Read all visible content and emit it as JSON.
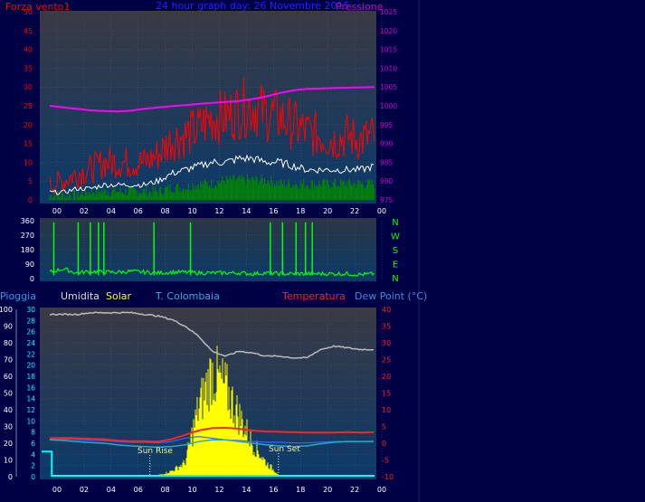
{
  "chart_data": [
    {
      "type": "line",
      "title": "24 hour graph day: 26 Novembre 2015",
      "left_axis_label": "Forza vento1",
      "right_axis_label": "Pressione",
      "x_ticks": [
        "00",
        "02",
        "04",
        "06",
        "08",
        "10",
        "12",
        "14",
        "16",
        "18",
        "20",
        "22",
        "00"
      ],
      "y_left_ticks": [
        "50",
        "45",
        "40",
        "35",
        "30",
        "25",
        "20",
        "15",
        "10",
        "5",
        "0"
      ],
      "y_right_ticks": [
        "1025",
        "1020",
        "1015",
        "1010",
        "1005",
        "1000",
        "995",
        "990",
        "985",
        "980",
        "975"
      ],
      "ylim_left": [
        0,
        50
      ],
      "ylim_right": [
        975,
        1025
      ],
      "x_hours": [
        0,
        1,
        2,
        3,
        4,
        5,
        6,
        7,
        8,
        9,
        10,
        11,
        12,
        13,
        14,
        15,
        16,
        17,
        18,
        19,
        20,
        21,
        22,
        23,
        24
      ],
      "series": [
        {
          "key": "gust",
          "color": "#ff0000",
          "axis": "left",
          "values": [
            4,
            5,
            7,
            8,
            10,
            10,
            10,
            10,
            12,
            16,
            17,
            19,
            22,
            22,
            24,
            25,
            23,
            22,
            20,
            18,
            17,
            16,
            17,
            16,
            17
          ]
        },
        {
          "key": "avg",
          "color": "#ffffff",
          "axis": "left",
          "values": [
            2,
            2,
            3,
            3,
            4,
            4,
            4,
            4,
            5,
            7,
            8,
            9,
            10,
            10,
            11,
            11,
            10,
            10,
            9,
            8,
            8,
            8,
            8,
            8,
            9
          ]
        },
        {
          "key": "speed",
          "color": "#008800",
          "axis": "left",
          "values": [
            1,
            1,
            1,
            2,
            2,
            2,
            2,
            2,
            2,
            3,
            3,
            4,
            4,
            5,
            5,
            5,
            5,
            4,
            4,
            4,
            4,
            4,
            4,
            4,
            4
          ]
        },
        {
          "key": "pressure",
          "color": "#ff00ff",
          "axis": "right",
          "values": [
            1000.0,
            999.6,
            999.2,
            998.8,
            998.6,
            998.5,
            998.7,
            999.2,
            999.6,
            999.9,
            1000.2,
            1000.5,
            1000.8,
            1001.0,
            1001.3,
            1001.8,
            1002.5,
            1003.4,
            1004.1,
            1004.5,
            1004.6,
            1004.7,
            1004.8,
            1004.9,
            1005.0
          ]
        }
      ]
    },
    {
      "type": "line",
      "title": "",
      "right_labels": [
        "N",
        "W",
        "S",
        "E",
        "N"
      ],
      "y_left_ticks": [
        "360",
        "270",
        "180",
        "90",
        "0"
      ],
      "ylim": [
        0,
        360
      ],
      "x_hours": [
        0,
        1,
        2,
        3,
        4,
        5,
        6,
        7,
        8,
        9,
        10,
        11,
        12,
        13,
        14,
        15,
        16,
        17,
        18,
        19,
        20,
        21,
        22,
        23,
        24
      ],
      "series": [
        {
          "key": "direction",
          "color": "#00ff00",
          "values": [
            40,
            60,
            35,
            45,
            40,
            40,
            45,
            40,
            35,
            40,
            40,
            35,
            35,
            35,
            35,
            30,
            35,
            30,
            30,
            30,
            30,
            30,
            30,
            25,
            30
          ]
        }
      ]
    },
    {
      "type": "line",
      "labels": [
        "Pioggia",
        "Umidita",
        "Solar",
        "T. Colombaia",
        "Temperatura",
        "Dew Point (°C)"
      ],
      "annotations": [
        "Sun Rise",
        "Sun Set"
      ],
      "x_ticks": [
        "00",
        "02",
        "04",
        "06",
        "08",
        "10",
        "12",
        "14",
        "16",
        "18",
        "20",
        "22",
        "00"
      ],
      "y_left_outer_ticks": [
        "100",
        "90",
        "80",
        "70",
        "60",
        "50",
        "40",
        "30",
        "20",
        "10",
        "0"
      ],
      "y_left_inner_ticks": [
        "30",
        "28",
        "26",
        "24",
        "22",
        "20",
        "18",
        "16",
        "14",
        "12",
        "10",
        "8",
        "6",
        "4",
        "2",
        "0"
      ],
      "y_right_ticks": [
        "40",
        "35",
        "30",
        "25",
        "20",
        "15",
        "10",
        "5",
        "0",
        "-5",
        "-10"
      ],
      "ylim_humidity": [
        0,
        100
      ],
      "ylim_temperature": [
        -10,
        40
      ],
      "x_hours": [
        0,
        1,
        2,
        3,
        4,
        5,
        6,
        7,
        8,
        9,
        10,
        11,
        12,
        13,
        14,
        15,
        16,
        17,
        18,
        19,
        20,
        21,
        22,
        23,
        24
      ],
      "series": [
        {
          "key": "humidity",
          "color": "#bbbbbb",
          "values": [
            97,
            97,
            97,
            98,
            98,
            98,
            98,
            97,
            96,
            94,
            90,
            84,
            75,
            72,
            75,
            74,
            72,
            72,
            71,
            71,
            76,
            78,
            77,
            76,
            76
          ]
        },
        {
          "key": "temperature",
          "color": "#ff2222",
          "values": [
            1.5,
            1.6,
            1.5,
            1.3,
            1.2,
            0.8,
            0.6,
            0.6,
            0.5,
            1.2,
            2.5,
            3.8,
            4.5,
            4.6,
            4.3,
            3.8,
            3.5,
            3.4,
            3.3,
            3.2,
            3.2,
            3.2,
            3.3,
            3.2,
            3.3
          ]
        },
        {
          "key": "tcolombaia",
          "color": "#2aa8cc",
          "values": [
            1.0,
            0.8,
            0.5,
            0.2,
            0.0,
            -0.5,
            -0.8,
            -1.0,
            -1.2,
            -1.0,
            -0.5,
            0.5,
            1.0,
            1.0,
            0.5,
            0.0,
            -0.5,
            -0.8,
            -1.0,
            -0.8,
            -0.2,
            0.3,
            0.5,
            0.5,
            0.5
          ]
        },
        {
          "key": "dewpoint",
          "color": "#3366ff",
          "values": [
            1.2,
            1.2,
            1.1,
            0.9,
            0.8,
            0.5,
            0.3,
            0.3,
            0.1,
            0.5,
            1.5,
            2.0,
            1.5,
            1.0,
            0.8,
            0.5,
            0.3,
            0.3,
            0.1,
            0.1,
            0.3,
            0.5,
            0.5,
            0.5,
            0.6
          ]
        },
        {
          "key": "solar",
          "color": "#ffff00",
          "values": [
            0,
            0,
            0,
            0,
            0,
            0,
            0,
            0,
            0.5,
            2,
            5,
            25,
            38,
            32,
            22,
            12,
            5,
            0.5,
            0,
            0,
            0,
            0,
            0,
            0,
            0
          ]
        },
        {
          "key": "rain",
          "color": "#00ffff",
          "values": [
            4.5,
            0,
            0,
            0,
            0,
            0,
            0,
            0,
            0,
            0,
            0,
            0,
            0,
            0,
            0,
            0,
            0,
            0,
            0,
            0,
            0,
            0,
            0,
            0,
            0
          ]
        }
      ]
    }
  ],
  "colors": {
    "bg": "#000044",
    "plot_top": "#333344",
    "plot_bottom": "#0a3a6a",
    "title": "#2222ff",
    "left_axis": "#ff0000",
    "right_axis": "#cc00cc"
  }
}
